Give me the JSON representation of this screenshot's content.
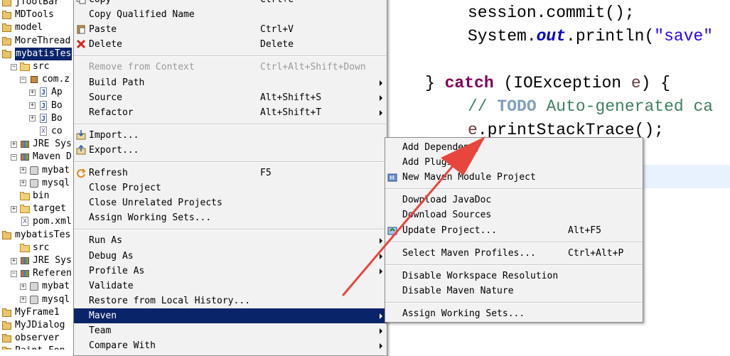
{
  "tree": {
    "items": [
      {
        "label": "jToolBar",
        "indent": 0,
        "twisty": "",
        "icon": "project"
      },
      {
        "label": "MDTools",
        "indent": 0,
        "twisty": "",
        "icon": "project"
      },
      {
        "label": "model",
        "indent": 0,
        "twisty": "",
        "icon": "project"
      },
      {
        "label": "MoreThread",
        "indent": 0,
        "twisty": "",
        "icon": "project"
      },
      {
        "label": "mybatisTes",
        "indent": 0,
        "twisty": "",
        "icon": "project",
        "selected": true
      },
      {
        "label": "src",
        "indent": 1,
        "twisty": "−",
        "icon": "folder"
      },
      {
        "label": "com.z",
        "indent": 2,
        "twisty": "−",
        "icon": "pkg"
      },
      {
        "label": "Ap",
        "indent": 3,
        "twisty": "+",
        "icon": "java"
      },
      {
        "label": "Bo",
        "indent": 3,
        "twisty": "+",
        "icon": "java"
      },
      {
        "label": "Bo",
        "indent": 3,
        "twisty": "+",
        "icon": "java"
      },
      {
        "label": "co",
        "indent": 3,
        "twisty": "",
        "icon": "xml"
      },
      {
        "label": "JRE Sys",
        "indent": 1,
        "twisty": "+",
        "icon": "lib"
      },
      {
        "label": "Maven D",
        "indent": 1,
        "twisty": "−",
        "icon": "lib"
      },
      {
        "label": "mybat",
        "indent": 2,
        "twisty": "+",
        "icon": "jar"
      },
      {
        "label": "mysql",
        "indent": 2,
        "twisty": "+",
        "icon": "jar"
      },
      {
        "label": "bin",
        "indent": 1,
        "twisty": "",
        "icon": "folder"
      },
      {
        "label": "target",
        "indent": 1,
        "twisty": "+",
        "icon": "folder"
      },
      {
        "label": "pom.xml",
        "indent": 1,
        "twisty": "",
        "icon": "xml"
      },
      {
        "label": "mybatisTes",
        "indent": 0,
        "twisty": "",
        "icon": "project"
      },
      {
        "label": "src",
        "indent": 1,
        "twisty": "",
        "icon": "folder"
      },
      {
        "label": "JRE Sys",
        "indent": 1,
        "twisty": "+",
        "icon": "lib"
      },
      {
        "label": "Referen",
        "indent": 1,
        "twisty": "−",
        "icon": "lib"
      },
      {
        "label": "mybat",
        "indent": 2,
        "twisty": "+",
        "icon": "jar"
      },
      {
        "label": "mysql",
        "indent": 2,
        "twisty": "+",
        "icon": "jar"
      },
      {
        "label": "MyFrame1",
        "indent": 0,
        "twisty": "",
        "icon": "project"
      },
      {
        "label": "MyJDialog",
        "indent": 0,
        "twisty": "",
        "icon": "project"
      },
      {
        "label": "observer",
        "indent": 0,
        "twisty": "",
        "icon": "project"
      },
      {
        "label": "Paint Fon",
        "indent": 0,
        "twisty": "",
        "icon": "project"
      }
    ]
  },
  "main_menu": {
    "items": [
      {
        "label": "Copy",
        "shortcut": "Ctrl+C",
        "icon": "copy-icon"
      },
      {
        "label": "Copy Qualified Name",
        "shortcut": "",
        "icon": "copy-qualified-icon"
      },
      {
        "label": "Paste",
        "shortcut": "Ctrl+V",
        "icon": "paste-icon"
      },
      {
        "label": "Delete",
        "shortcut": "Delete",
        "icon": "delete-icon"
      },
      {
        "sep": true
      },
      {
        "label": "Remove from Context",
        "shortcut": "Ctrl+Alt+Shift+Down",
        "disabled": true
      },
      {
        "label": "Build Path",
        "submenu": true
      },
      {
        "label": "Source",
        "shortcut": "Alt+Shift+S",
        "submenu": true
      },
      {
        "label": "Refactor",
        "shortcut": "Alt+Shift+T",
        "submenu": true
      },
      {
        "sep": true
      },
      {
        "label": "Import...",
        "icon": "import-icon"
      },
      {
        "label": "Export...",
        "icon": "export-icon"
      },
      {
        "sep": true
      },
      {
        "label": "Refresh",
        "shortcut": "F5",
        "icon": "refresh-icon"
      },
      {
        "label": "Close Project"
      },
      {
        "label": "Close Unrelated Projects"
      },
      {
        "label": "Assign Working Sets..."
      },
      {
        "sep": true
      },
      {
        "label": "Run As",
        "submenu": true
      },
      {
        "label": "Debug As",
        "submenu": true
      },
      {
        "label": "Profile As",
        "submenu": true
      },
      {
        "label": "Validate"
      },
      {
        "label": "Restore from Local History..."
      },
      {
        "label": "Maven",
        "submenu": true,
        "highlighted": true
      },
      {
        "label": "Team",
        "submenu": true
      },
      {
        "label": "Compare With",
        "submenu": true
      }
    ]
  },
  "maven_menu": {
    "items": [
      {
        "label": "Add Dependency"
      },
      {
        "label": "Add Plugin"
      },
      {
        "label": "New Maven Module Project",
        "icon": "maven-module-icon"
      },
      {
        "sep": true
      },
      {
        "label": "Download JavaDoc"
      },
      {
        "label": "Download Sources"
      },
      {
        "label": "Update Project...",
        "shortcut": "Alt+F5",
        "icon": "update-project-icon"
      },
      {
        "sep": true
      },
      {
        "label": "Select Maven Profiles...",
        "shortcut": "Ctrl+Alt+P"
      },
      {
        "sep": true
      },
      {
        "label": "Disable Workspace Resolution"
      },
      {
        "label": "Disable Maven Nature"
      },
      {
        "sep": true
      },
      {
        "label": "Assign Working Sets..."
      }
    ]
  },
  "editor": {
    "line1_ident": "session",
    "line1_rest": ".commit();",
    "line2_a": "System.",
    "line2_field": "out",
    "line2_b": ".println(",
    "line2_str": "\"save\"",
    "line3_brace": "} ",
    "line3_kw": "catch",
    "line3_rest": " (IOException ",
    "line3_var": "e",
    "line3_end": ") {",
    "line4_slashes": "// ",
    "line4_todo": "TODO",
    "line4_rest": " Auto-generated ca",
    "line5_var": "e",
    "line5_rest": ".printStackTrace();"
  },
  "colors": {
    "selection": "#0a246a",
    "keyword": "#7f0055",
    "string": "#2a00ff",
    "comment": "#3f7f5f",
    "annotation_arrow": "#e8463c"
  }
}
